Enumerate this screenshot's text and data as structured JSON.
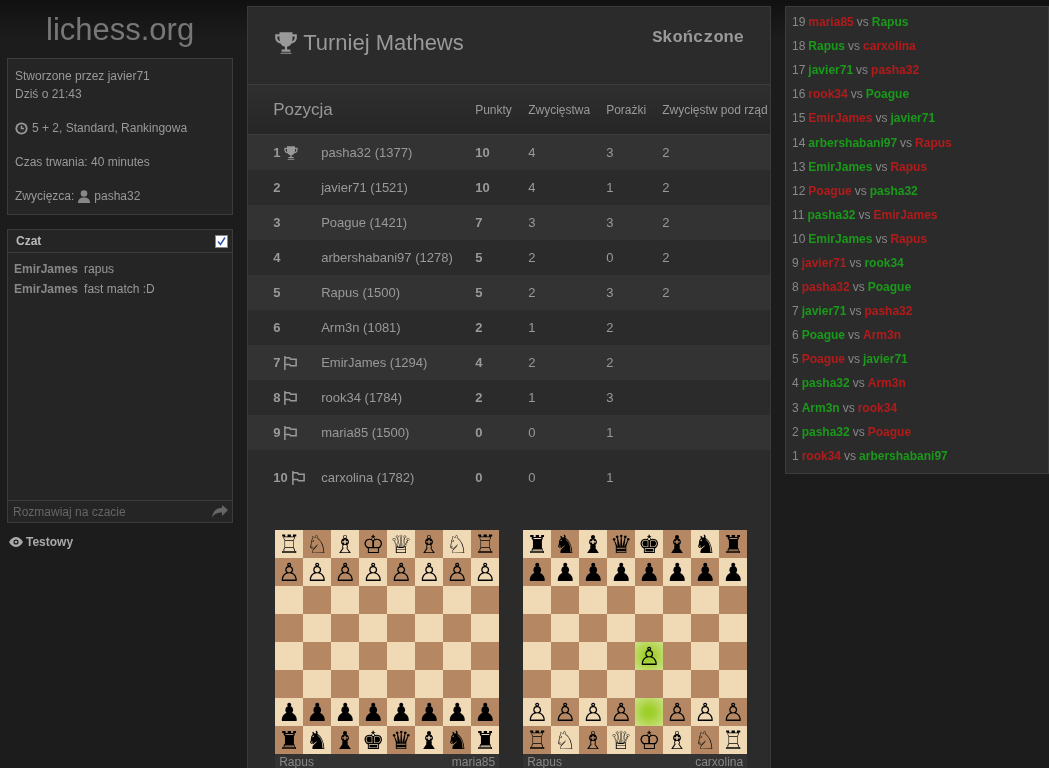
{
  "logo": "lichess.org",
  "info": {
    "created_by": "Stworzone przez javier71",
    "date": "Dziś o 21:43",
    "clock": "5 + 2, Standard, Rankingowa",
    "duration": "Czas trwania: 40 minutes",
    "winner_label": "Zwycięzca:",
    "winner": "pasha32"
  },
  "chat": {
    "title": "Czat",
    "enabled": true,
    "messages": [
      {
        "user": "EmirJames",
        "text": "rapus"
      },
      {
        "user": "EmirJames",
        "text": "fast match :D"
      }
    ],
    "placeholder": "Rozmawiaj na czacie"
  },
  "watchers": {
    "label": "Testowy"
  },
  "tournament": {
    "title": "Turniej Mathews",
    "status": "Skończone",
    "columns": [
      "Pozycja",
      "Punkty",
      "Zwycięstwa",
      "Porażki",
      "Zwycięstw pod rząd"
    ],
    "rows": [
      {
        "rank": "1",
        "kind": "winner",
        "player": "pasha32 (1377)",
        "points": "10",
        "wins": "4",
        "losses": "3",
        "streak": "2"
      },
      {
        "rank": "2",
        "kind": "normal",
        "player": "javier71 (1521)",
        "points": "10",
        "wins": "4",
        "losses": "1",
        "streak": "2"
      },
      {
        "rank": "3",
        "kind": "normal",
        "player": "Poague (1421)",
        "points": "7",
        "wins": "3",
        "losses": "3",
        "streak": "2"
      },
      {
        "rank": "4",
        "kind": "normal",
        "player": "arbershabani97 (1278)",
        "points": "5",
        "wins": "2",
        "losses": "0",
        "streak": "2"
      },
      {
        "rank": "5",
        "kind": "normal",
        "player": "Rapus (1500)",
        "points": "5",
        "wins": "2",
        "losses": "3",
        "streak": "2"
      },
      {
        "rank": "6",
        "kind": "normal",
        "player": "Arm3n (1081)",
        "points": "2",
        "wins": "1",
        "losses": "2"
      },
      {
        "rank": "7",
        "kind": "withdrawn",
        "player": "EmirJames (1294)",
        "points": "4",
        "wins": "2",
        "losses": "2"
      },
      {
        "rank": "8",
        "kind": "withdrawn",
        "player": "rook34 (1784)",
        "points": "2",
        "wins": "1",
        "losses": "3"
      },
      {
        "rank": "9",
        "kind": "withdrawn",
        "player": "maria85 (1500)",
        "points": "0",
        "wins": "0",
        "losses": "1"
      },
      {
        "rank": "10",
        "kind": "withdrawn",
        "player": "carxolina (1782)",
        "points": "0",
        "wins": "0",
        "losses": "1"
      }
    ],
    "boards": [
      {
        "ranks": [
          [
            {
              "piece": "♖",
              "highlighted": false
            },
            {
              "piece": "♘",
              "highlighted": false
            },
            {
              "piece": "♗",
              "highlighted": false
            },
            {
              "piece": "♔",
              "highlighted": false
            },
            {
              "piece": "♕",
              "highlighted": false
            },
            {
              "piece": "♗",
              "highlighted": false
            },
            {
              "piece": "♘",
              "highlighted": false
            },
            {
              "piece": "♖",
              "highlighted": false
            }
          ],
          [
            {
              "piece": "♙",
              "highlighted": false
            },
            {
              "piece": "♙",
              "highlighted": false
            },
            {
              "piece": "♙",
              "highlighted": false
            },
            {
              "piece": "♙",
              "highlighted": false
            },
            {
              "piece": "♙",
              "highlighted": false
            },
            {
              "piece": "♙",
              "highlighted": false
            },
            {
              "piece": "♙",
              "highlighted": false
            },
            {
              "piece": "♙",
              "highlighted": false
            }
          ],
          [
            {
              "highlighted": false
            },
            {
              "highlighted": false
            },
            {
              "highlighted": false
            },
            {
              "highlighted": false
            },
            {
              "highlighted": false
            },
            {
              "highlighted": false
            },
            {
              "highlighted": false
            },
            {
              "highlighted": false
            }
          ],
          [
            {
              "highlighted": false
            },
            {
              "highlighted": false
            },
            {
              "highlighted": false
            },
            {
              "highlighted": false
            },
            {
              "highlighted": false
            },
            {
              "highlighted": false
            },
            {
              "highlighted": false
            },
            {
              "highlighted": false
            }
          ],
          [
            {
              "highlighted": false
            },
            {
              "highlighted": false
            },
            {
              "highlighted": false
            },
            {
              "highlighted": false
            },
            {
              "highlighted": false
            },
            {
              "highlighted": false
            },
            {
              "highlighted": false
            },
            {
              "highlighted": false
            }
          ],
          [
            {
              "highlighted": false
            },
            {
              "highlighted": false
            },
            {
              "highlighted": false
            },
            {
              "highlighted": false
            },
            {
              "highlighted": false
            },
            {
              "highlighted": false
            },
            {
              "highlighted": false
            },
            {
              "highlighted": false
            }
          ],
          [
            {
              "piece": "♟",
              "highlighted": false
            },
            {
              "piece": "♟",
              "highlighted": false
            },
            {
              "piece": "♟",
              "highlighted": false
            },
            {
              "piece": "♟",
              "highlighted": false
            },
            {
              "piece": "♟",
              "highlighted": false
            },
            {
              "piece": "♟",
              "highlighted": false
            },
            {
              "piece": "♟",
              "highlighted": false
            },
            {
              "piece": "♟",
              "highlighted": false
            }
          ],
          [
            {
              "piece": "♜",
              "highlighted": false
            },
            {
              "piece": "♞",
              "highlighted": false
            },
            {
              "piece": "♝",
              "highlighted": false
            },
            {
              "piece": "♚",
              "highlighted": false
            },
            {
              "piece": "♛",
              "highlighted": false
            },
            {
              "piece": "♝",
              "highlighted": false
            },
            {
              "piece": "♞",
              "highlighted": false
            },
            {
              "piece": "♜",
              "highlighted": false
            }
          ]
        ],
        "left_player": "Rapus",
        "right_player": "maria85"
      },
      {
        "ranks": [
          [
            {
              "piece": "♜",
              "highlighted": false
            },
            {
              "piece": "♞",
              "highlighted": false
            },
            {
              "piece": "♝",
              "highlighted": false
            },
            {
              "piece": "♛",
              "highlighted": false
            },
            {
              "piece": "♚",
              "highlighted": false
            },
            {
              "piece": "♝",
              "highlighted": false
            },
            {
              "piece": "♞",
              "highlighted": false
            },
            {
              "piece": "♜",
              "highlighted": false
            }
          ],
          [
            {
              "piece": "♟",
              "highlighted": false
            },
            {
              "piece": "♟",
              "highlighted": false
            },
            {
              "piece": "♟",
              "highlighted": false
            },
            {
              "piece": "♟",
              "highlighted": false
            },
            {
              "piece": "♟",
              "highlighted": false
            },
            {
              "piece": "♟",
              "highlighted": false
            },
            {
              "piece": "♟",
              "highlighted": false
            },
            {
              "piece": "♟",
              "highlighted": false
            }
          ],
          [
            {
              "highlighted": false
            },
            {
              "highlighted": false
            },
            {
              "highlighted": false
            },
            {
              "highlighted": false
            },
            {
              "highlighted": false
            },
            {
              "highlighted": false
            },
            {
              "highlighted": false
            },
            {
              "highlighted": false
            }
          ],
          [
            {
              "highlighted": false
            },
            {
              "highlighted": false
            },
            {
              "highlighted": false
            },
            {
              "highlighted": false
            },
            {
              "highlighted": false
            },
            {
              "highlighted": false
            },
            {
              "highlighted": false
            },
            {
              "highlighted": false
            }
          ],
          [
            {
              "highlighted": false
            },
            {
              "highlighted": false
            },
            {
              "highlighted": false
            },
            {
              "highlighted": false
            },
            {
              "piece": "♙",
              "highlighted": true
            },
            {
              "highlighted": false
            },
            {
              "highlighted": false
            },
            {
              "highlighted": false
            }
          ],
          [
            {
              "highlighted": false
            },
            {
              "highlighted": false
            },
            {
              "highlighted": false
            },
            {
              "highlighted": false
            },
            {
              "highlighted": false
            },
            {
              "highlighted": false
            },
            {
              "highlighted": false
            },
            {
              "highlighted": false
            }
          ],
          [
            {
              "piece": "♙",
              "highlighted": false
            },
            {
              "piece": "♙",
              "highlighted": false
            },
            {
              "piece": "♙",
              "highlighted": false
            },
            {
              "piece": "♙",
              "highlighted": false
            },
            {
              "highlighted": true
            },
            {
              "piece": "♙",
              "highlighted": false
            },
            {
              "piece": "♙",
              "highlighted": false
            },
            {
              "piece": "♙",
              "highlighted": false
            }
          ],
          [
            {
              "piece": "♖",
              "highlighted": false
            },
            {
              "piece": "♘",
              "highlighted": false
            },
            {
              "piece": "♗",
              "highlighted": false
            },
            {
              "piece": "♕",
              "highlighted": false
            },
            {
              "piece": "♔",
              "highlighted": false
            },
            {
              "piece": "♗",
              "highlighted": false
            },
            {
              "piece": "♘",
              "highlighted": false
            },
            {
              "piece": "♖",
              "highlighted": false
            }
          ]
        ],
        "left_player": "Rapus",
        "right_player": "carxolina"
      }
    ]
  },
  "games": [
    {
      "number": "19",
      "white": {
        "name": "maria85",
        "color": "#b31b1b"
      },
      "vs": "vs",
      "black": {
        "name": "Rapus",
        "color": "#1a9a1a"
      }
    },
    {
      "number": "18",
      "white": {
        "name": "Rapus",
        "color": "#1a9a1a"
      },
      "vs": "vs",
      "black": {
        "name": "carxolina",
        "color": "#b31b1b"
      }
    },
    {
      "number": "17",
      "white": {
        "name": "javier71",
        "color": "#1a9a1a"
      },
      "vs": "vs",
      "black": {
        "name": "pasha32",
        "color": "#b31b1b"
      }
    },
    {
      "number": "16",
      "white": {
        "name": "rook34",
        "color": "#b31b1b"
      },
      "vs": "vs",
      "black": {
        "name": "Poague",
        "color": "#1a9a1a"
      }
    },
    {
      "number": "15",
      "white": {
        "name": "EmirJames",
        "color": "#b31b1b"
      },
      "vs": "vs",
      "black": {
        "name": "javier71",
        "color": "#1a9a1a"
      }
    },
    {
      "number": "14",
      "white": {
        "name": "arbershabani97",
        "color": "#1a9a1a"
      },
      "vs": "vs",
      "black": {
        "name": "Rapus",
        "color": "#b31b1b"
      }
    },
    {
      "number": "13",
      "white": {
        "name": "EmirJames",
        "color": "#1a9a1a"
      },
      "vs": "vs",
      "black": {
        "name": "Rapus",
        "color": "#b31b1b"
      }
    },
    {
      "number": "12",
      "white": {
        "name": "Poague",
        "color": "#b31b1b"
      },
      "vs": "vs",
      "black": {
        "name": "pasha32",
        "color": "#1a9a1a"
      }
    },
    {
      "number": "11",
      "white": {
        "name": "pasha32",
        "color": "#1a9a1a"
      },
      "vs": "vs",
      "black": {
        "name": "EmirJames",
        "color": "#b31b1b"
      }
    },
    {
      "number": "10",
      "white": {
        "name": "EmirJames",
        "color": "#1a9a1a"
      },
      "vs": "vs",
      "black": {
        "name": "Rapus",
        "color": "#b31b1b"
      }
    },
    {
      "number": "9",
      "white": {
        "name": "javier71",
        "color": "#b31b1b"
      },
      "vs": "vs",
      "black": {
        "name": "rook34",
        "color": "#1a9a1a"
      }
    },
    {
      "number": "8",
      "white": {
        "name": "pasha32",
        "color": "#b31b1b"
      },
      "vs": "vs",
      "black": {
        "name": "Poague",
        "color": "#1a9a1a"
      }
    },
    {
      "number": "7",
      "white": {
        "name": "javier71",
        "color": "#1a9a1a"
      },
      "vs": "vs",
      "black": {
        "name": "pasha32",
        "color": "#b31b1b"
      }
    },
    {
      "number": "6",
      "white": {
        "name": "Poague",
        "color": "#1a9a1a"
      },
      "vs": "vs",
      "black": {
        "name": "Arm3n",
        "color": "#b31b1b"
      }
    },
    {
      "number": "5",
      "white": {
        "name": "Poague",
        "color": "#b31b1b"
      },
      "vs": "vs",
      "black": {
        "name": "javier71",
        "color": "#1a9a1a"
      }
    },
    {
      "number": "4",
      "white": {
        "name": "pasha32",
        "color": "#1a9a1a"
      },
      "vs": "vs",
      "black": {
        "name": "Arm3n",
        "color": "#b31b1b"
      }
    },
    {
      "number": "3",
      "white": {
        "name": "Arm3n",
        "color": "#1a9a1a"
      },
      "vs": "vs",
      "black": {
        "name": "rook34",
        "color": "#b31b1b"
      }
    },
    {
      "number": "2",
      "white": {
        "name": "pasha32",
        "color": "#1a9a1a"
      },
      "vs": "vs",
      "black": {
        "name": "Poague",
        "color": "#b31b1b"
      }
    },
    {
      "number": "1",
      "white": {
        "name": "rook34",
        "color": "#b31b1b"
      },
      "vs": "vs",
      "black": {
        "name": "arbershabani97",
        "color": "#1a9a1a"
      }
    }
  ]
}
